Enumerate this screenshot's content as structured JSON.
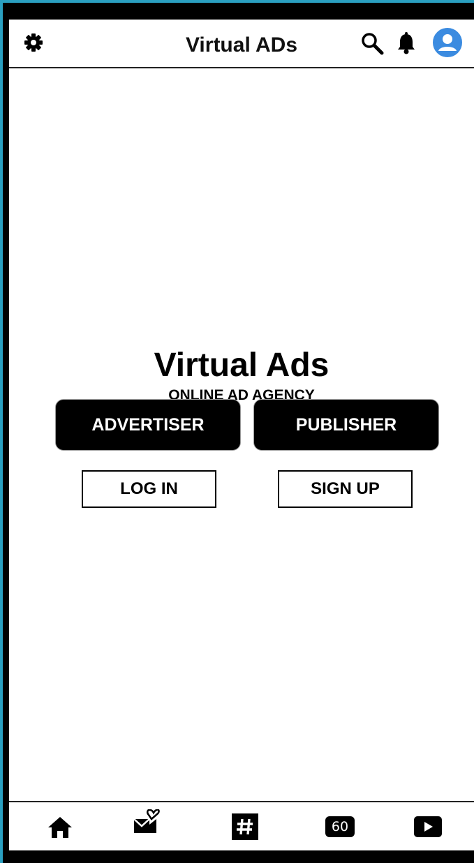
{
  "header": {
    "title": "Virtual ADs",
    "icons": [
      "gear-icon",
      "search-icon",
      "bell-icon",
      "user-avatar-icon"
    ]
  },
  "main": {
    "brand": "Virtual Ads",
    "tagline": "ONLINE AD AGENCY",
    "advertiser_label": "ADVERTISER",
    "publisher_label": "PUBLISHER",
    "login_label": "LOG IN",
    "signup_label": "SIGN UP"
  },
  "bottom_nav": {
    "items": [
      "home-icon",
      "love-mail-icon",
      "hashtag-icon",
      "sixty-badge-icon",
      "play-icon"
    ],
    "badge_text": "60"
  },
  "colors": {
    "frame": "#000000",
    "outer_background": "#2a9fc0",
    "avatar": "#3b8be0"
  }
}
